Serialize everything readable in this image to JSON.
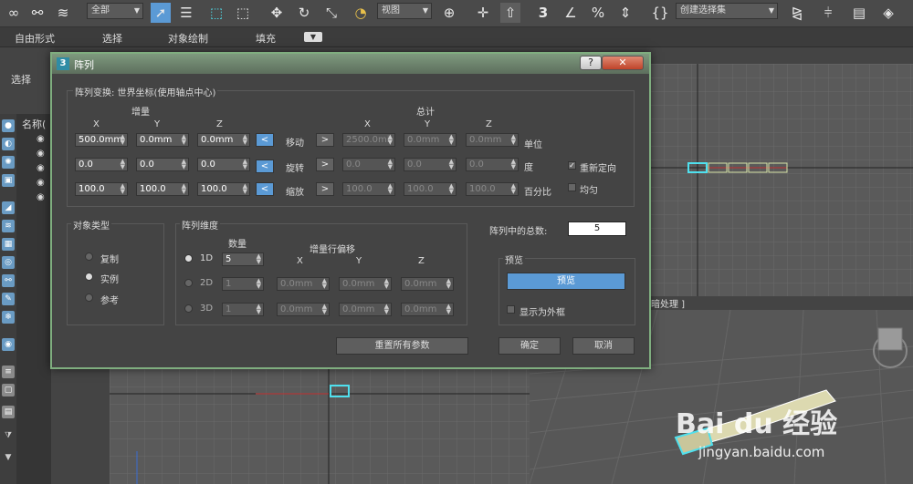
{
  "toolbar": {
    "filter_select": "全部",
    "view_select": "视图",
    "selection_set_select": "创建选择集",
    "snap_number": "3"
  },
  "ribbon": {
    "tabs": [
      "自由形式",
      "选择",
      "对象绘制",
      "填充"
    ]
  },
  "scene": {
    "select_label": "选择",
    "name_column": "名称("
  },
  "viewport": {
    "bottom_right_label": "暗处理 ]"
  },
  "dialog": {
    "title": "阵列",
    "help_label": "?",
    "close_label": "✕",
    "transform_group": "阵列变换: 世界坐标(使用轴点中心)",
    "increment_header": "增量",
    "total_header": "总计",
    "axis": [
      "X",
      "Y",
      "Z"
    ],
    "rows": [
      {
        "inc": [
          "500.0mm",
          "0.0mm",
          "0.0mm"
        ],
        "label": "移动",
        "total": [
          "2500.0mi",
          "0.0mm",
          "0.0mm"
        ],
        "unit": "单位",
        "left_arrow_active": true
      },
      {
        "inc": [
          "0.0",
          "0.0",
          "0.0"
        ],
        "label": "旋转",
        "total": [
          "0.0",
          "0.0",
          "0.0"
        ],
        "unit": "度",
        "left_arrow_active": true
      },
      {
        "inc": [
          "100.0",
          "100.0",
          "100.0"
        ],
        "label": "缩放",
        "total": [
          "100.0",
          "100.0",
          "100.0"
        ],
        "unit": "百分比",
        "left_arrow_active": true
      }
    ],
    "left_arrow": "<",
    "right_arrow": ">",
    "reorient_label": "重新定向",
    "reorient_checked": true,
    "uniform_label": "均匀",
    "uniform_checked": false,
    "object_type_group": "对象类型",
    "object_types": [
      "复制",
      "实例",
      "参考"
    ],
    "object_type_selected": 1,
    "dimensions_group": "阵列维度",
    "count_header": "数量",
    "incremental_row_offset": "增量行偏移",
    "dims": [
      {
        "label": "1D",
        "count": "5",
        "offsets": []
      },
      {
        "label": "2D",
        "count": "1",
        "offsets": [
          "0.0mm",
          "0.0mm",
          "0.0mm"
        ]
      },
      {
        "label": "3D",
        "count": "1",
        "offsets": [
          "0.0mm",
          "0.0mm",
          "0.0mm"
        ]
      }
    ],
    "dim_selected": 0,
    "total_in_array_label": "阵列中的总数:",
    "total_in_array_value": "5",
    "preview_group": "预览",
    "preview_button": "预览",
    "show_as_box_label": "显示为外框",
    "show_as_box_checked": false,
    "reset_button": "重置所有参数",
    "ok_button": "确定",
    "cancel_button": "取消"
  },
  "watermark": {
    "brand": "Bai du 经验",
    "url": "jingyan.baidu.com"
  },
  "colors": {
    "accent": "#5b9ad5",
    "dialog_border": "#7fae7f",
    "selection": "#4fe0ee"
  }
}
